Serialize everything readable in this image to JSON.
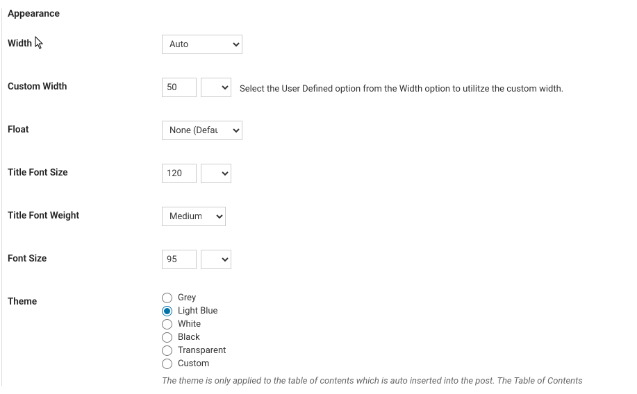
{
  "section_title": "Appearance",
  "width": {
    "label": "Width",
    "value": "Auto"
  },
  "custom_width": {
    "label": "Custom Width",
    "value": "50",
    "unit": "%",
    "hint": "Select the User Defined option from the Width option to utilitze the custom width."
  },
  "float": {
    "label": "Float",
    "value": "None (Default)"
  },
  "title_font_size": {
    "label": "Title Font Size",
    "value": "120",
    "unit": "%"
  },
  "title_font_weight": {
    "label": "Title Font Weight",
    "value": "Medium"
  },
  "font_size": {
    "label": "Font Size",
    "value": "95",
    "unit": "%"
  },
  "theme": {
    "label": "Theme",
    "options": {
      "0": "Grey",
      "1": "Light Blue",
      "2": "White",
      "3": "Black",
      "4": "Transparent",
      "5": "Custom"
    },
    "selected_index": 1,
    "note": "The theme is only applied to the table of contents which is auto inserted into the post. The Table of Contents"
  }
}
